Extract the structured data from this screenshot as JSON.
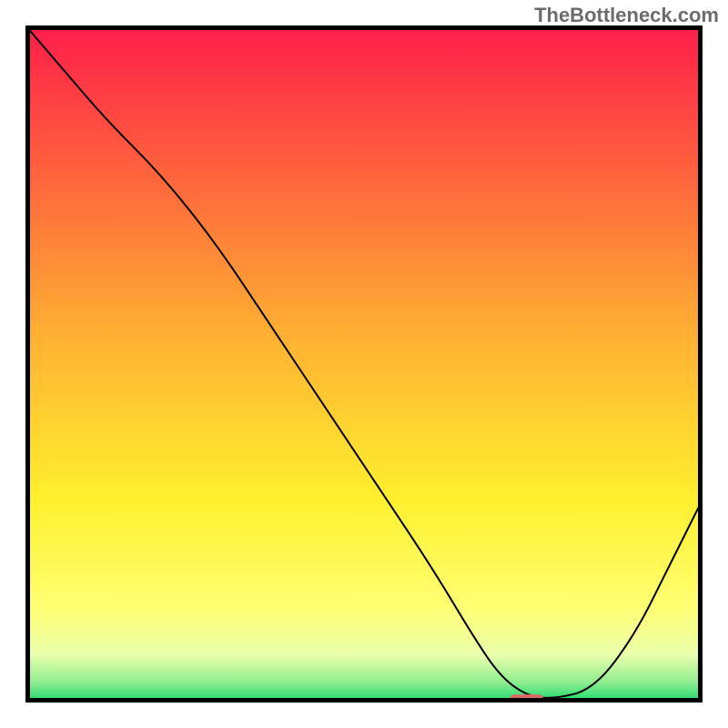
{
  "watermark": {
    "text": "TheBottleneck.com"
  },
  "chart_data": {
    "type": "line",
    "title": "",
    "xlabel": "",
    "ylabel": "",
    "xlim": [
      0,
      100
    ],
    "ylim": [
      0,
      100
    ],
    "grid": false,
    "legend": false,
    "background_gradient": {
      "direction": "vertical",
      "stops": [
        {
          "pct": 0,
          "color": "#ff1d4a"
        },
        {
          "pct": 20,
          "color": "#ff5d3e"
        },
        {
          "pct": 45,
          "color": "#ffae33"
        },
        {
          "pct": 70,
          "color": "#fff02e"
        },
        {
          "pct": 86,
          "color": "#ffff73"
        },
        {
          "pct": 93,
          "color": "#e9ffab"
        },
        {
          "pct": 97,
          "color": "#90ee90"
        },
        {
          "pct": 100,
          "color": "#17d86f"
        }
      ]
    },
    "series": [
      {
        "name": "bottleneck-curve",
        "x": [
          0,
          6,
          12,
          20,
          28,
          36,
          44,
          52,
          60,
          66,
          70,
          74,
          78,
          84,
          90,
          95,
          100
        ],
        "values": [
          100,
          93,
          86,
          78,
          68,
          56,
          44,
          32,
          20,
          10,
          4,
          1,
          0.5,
          2,
          10,
          20,
          30
        ]
      }
    ],
    "marker": {
      "name": "optimal-range",
      "x": 74,
      "y": 0.5,
      "width_pct": 5,
      "height_pct": 1.4,
      "color": "#d86a6a"
    }
  }
}
